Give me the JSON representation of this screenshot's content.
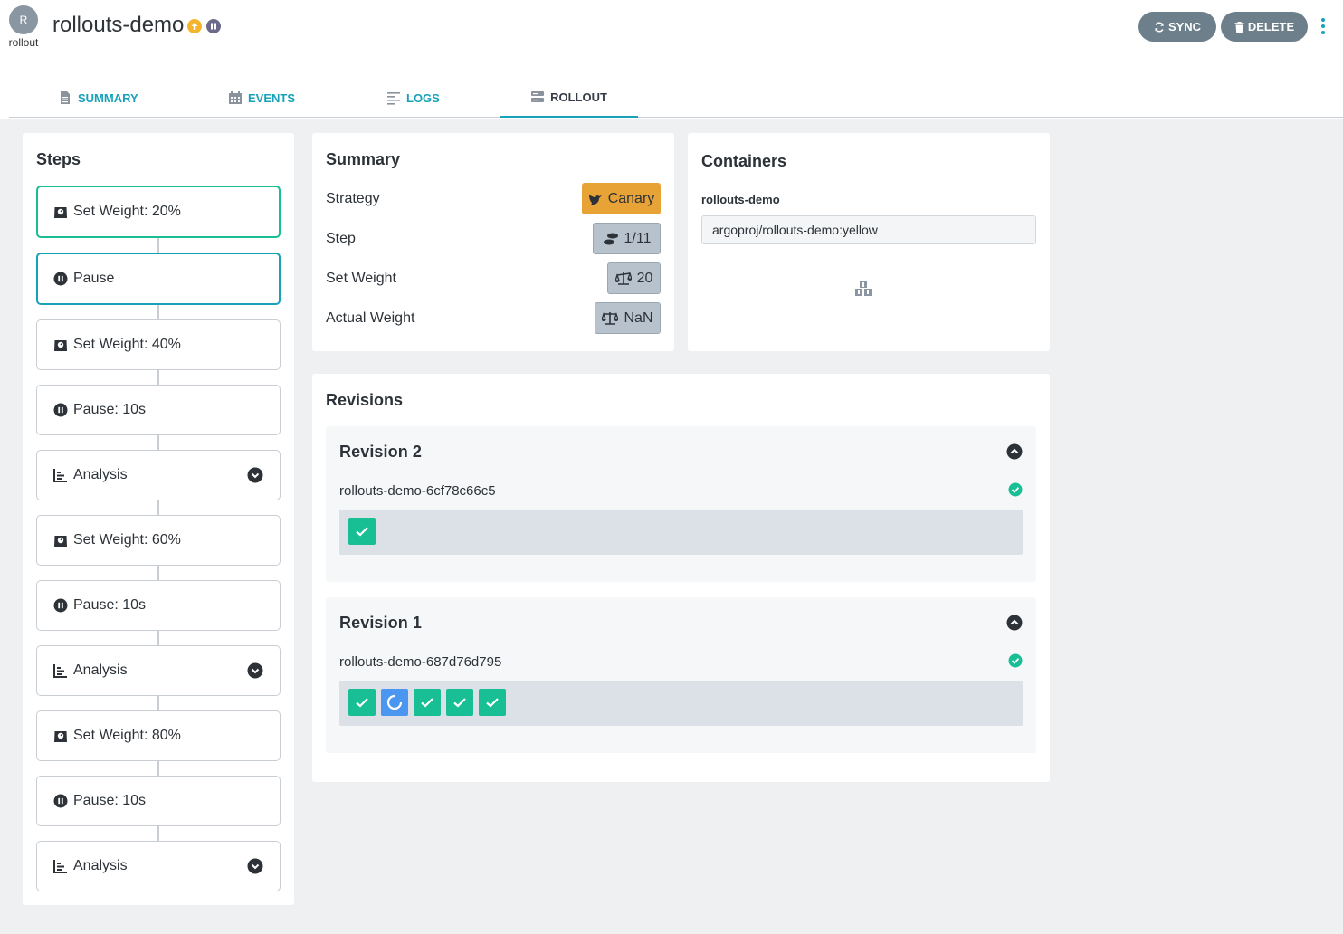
{
  "app": {
    "avatar_letter": "R",
    "kind": "rollout",
    "name": "rollouts-demo",
    "actions": {
      "sync": "SYNC",
      "delete": "DELETE"
    }
  },
  "tabs": [
    {
      "label": "SUMMARY",
      "icon": "file-icon"
    },
    {
      "label": "EVENTS",
      "icon": "calendar-icon"
    },
    {
      "label": "LOGS",
      "icon": "align-left-icon"
    },
    {
      "label": "ROLLOUT",
      "icon": "server-icon",
      "active": true
    }
  ],
  "steps": {
    "title": "Steps",
    "items": [
      {
        "label": "Set Weight: 20%",
        "icon": "weight-icon",
        "state": "done"
      },
      {
        "label": "Pause",
        "icon": "pause-circle-icon",
        "state": "current"
      },
      {
        "label": "Set Weight: 40%",
        "icon": "weight-icon",
        "state": "pending"
      },
      {
        "label": "Pause: 10s",
        "icon": "pause-circle-icon",
        "state": "pending"
      },
      {
        "label": "Analysis",
        "icon": "chart-bar-icon",
        "state": "pending",
        "expandable": true
      },
      {
        "label": "Set Weight: 60%",
        "icon": "weight-icon",
        "state": "pending"
      },
      {
        "label": "Pause: 10s",
        "icon": "pause-circle-icon",
        "state": "pending"
      },
      {
        "label": "Analysis",
        "icon": "chart-bar-icon",
        "state": "pending",
        "expandable": true
      },
      {
        "label": "Set Weight: 80%",
        "icon": "weight-icon",
        "state": "pending"
      },
      {
        "label": "Pause: 10s",
        "icon": "pause-circle-icon",
        "state": "pending"
      },
      {
        "label": "Analysis",
        "icon": "chart-bar-icon",
        "state": "pending",
        "expandable": true
      }
    ]
  },
  "summary": {
    "title": "Summary",
    "strategy_label": "Strategy",
    "strategy_value": "Canary",
    "step_label": "Step",
    "step_value": "1/11",
    "set_weight_label": "Set Weight",
    "set_weight_value": "20",
    "actual_weight_label": "Actual Weight",
    "actual_weight_value": "NaN"
  },
  "containers": {
    "title": "Containers",
    "name": "rollouts-demo",
    "image": "argoproj/rollouts-demo:yellow"
  },
  "revisions": {
    "title": "Revisions",
    "items": [
      {
        "title": "Revision 2",
        "replicaset": "rollouts-demo-6cf78c66c5",
        "pods": [
          "ready"
        ]
      },
      {
        "title": "Revision 1",
        "replicaset": "rollouts-demo-687d76d795",
        "pods": [
          "ready",
          "progressing",
          "ready",
          "ready",
          "ready"
        ]
      }
    ]
  },
  "colors": {
    "accent": "#17a2b8",
    "success": "#18be94",
    "progressing": "#4b96f0",
    "canary": "#e8a336",
    "health_warning": "#f4b52c"
  }
}
